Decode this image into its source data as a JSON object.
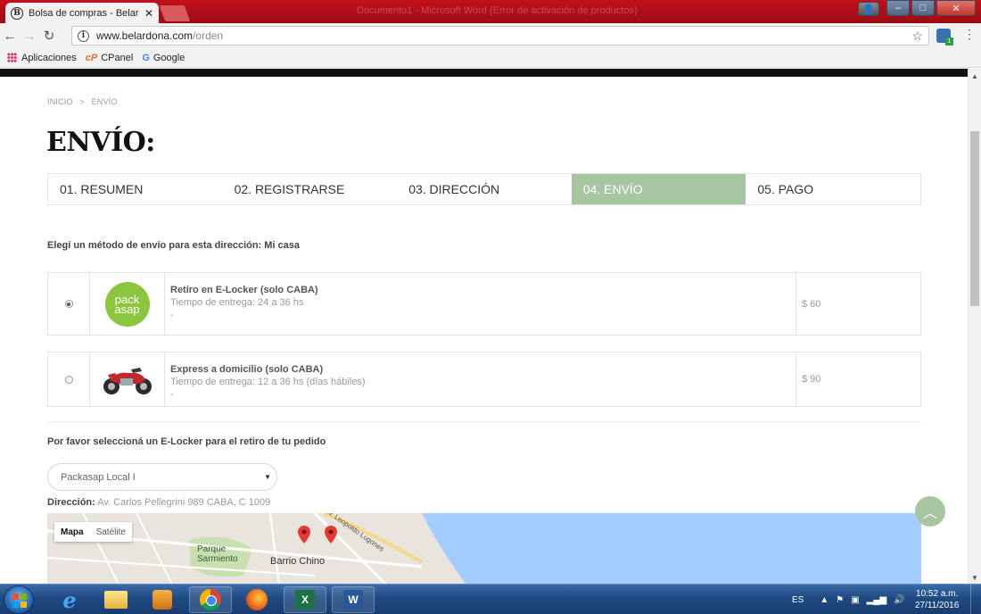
{
  "browser": {
    "tab_title": "Bolsa de compras - Belar",
    "tab_favicon": "B",
    "tab_close": "✕",
    "faded_title": "Documento1 - Microsoft Word (Error de activación de productos)",
    "url_host": "www.belardona.com",
    "url_path": "/orden",
    "bookmarks": [
      "Aplicaciones",
      "CPanel",
      "Google"
    ],
    "ext_badge": "1"
  },
  "page": {
    "breadcrumb": [
      "INICIO",
      ">",
      "ENVÍO"
    ],
    "title": "ENVÍO:",
    "steps": [
      {
        "label": "01. RESUMEN",
        "active": false
      },
      {
        "label": "02. REGISTRARSE",
        "active": false
      },
      {
        "label": "03. DIRECCIÓN",
        "active": false
      },
      {
        "label": "04. ENVÍO",
        "active": true
      },
      {
        "label": "05. PAGO",
        "active": false
      }
    ],
    "method_heading": "Elegí un método de envío para esta dirección: Mi casa",
    "options": [
      {
        "name": "Retiro en E-Locker (solo CABA)",
        "delivery": "Tiempo de entrega: 24 a 36 hs",
        "extra": "-",
        "price": "$ 60",
        "selected": true,
        "logo_line1": "pack",
        "logo_line2": "asap"
      },
      {
        "name": "Express a domicilio (solo CABA)",
        "delivery": "Tiempo de entrega: 12 a 36 hs (días hábiles)",
        "extra": "-",
        "price": "$ 90",
        "selected": false
      }
    ],
    "elocker_heading": "Por favor seleccioná un E-Locker para el retiro de tu pedido",
    "elocker_select": "Packasap Local I",
    "address_label": "Dirección:",
    "address_value": "Av. Carlos Pellegrini 989 CABA, C 1009",
    "map": {
      "tabs": [
        "Mapa",
        "Satélite"
      ],
      "labels": {
        "park": "Parque Sarmiento",
        "barrio": "Barrio Chino",
        "avenue": "Av. Leopoldo Lugones"
      }
    },
    "back_to_top": "︿"
  },
  "taskbar": {
    "lang": "ES",
    "time": "10:52 a.m.",
    "date": "27/11/2016"
  },
  "colors": {
    "accent_green": "#a8c5a2",
    "pack_green": "#8cc63f",
    "titlebar_red": "#c4101a"
  }
}
